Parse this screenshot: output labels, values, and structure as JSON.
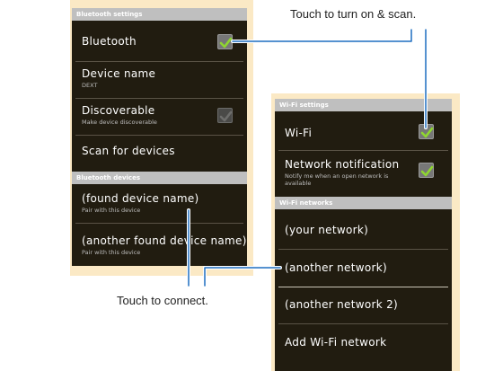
{
  "callouts": {
    "scan": "Touch to turn on & scan.",
    "connect": "Touch to connect."
  },
  "bluetooth_panel": {
    "header_settings": "Bluetooth settings",
    "bluetooth_label": "Bluetooth",
    "bluetooth_checked": true,
    "device_name_label": "Device name",
    "device_name_value": "DEXT",
    "discoverable_label": "Discoverable",
    "discoverable_sub": "Make device discoverable",
    "discoverable_checked": true,
    "scan_label": "Scan for devices",
    "header_devices": "Bluetooth devices",
    "devices": [
      {
        "name": "(found device name)",
        "sub": "Pair with this device"
      },
      {
        "name": "(another found device name)",
        "sub": "Pair with this device"
      }
    ]
  },
  "wifi_panel": {
    "header_settings": "Wi-Fi settings",
    "wifi_label": "Wi-Fi",
    "wifi_checked": true,
    "notification_label": "Network notification",
    "notification_sub_line1": "Notify me when an open network is",
    "notification_sub_line2": "available",
    "notification_checked": true,
    "header_networks": "Wi-Fi networks",
    "networks": [
      "(your network)",
      "(another network)",
      "(another network 2)"
    ],
    "add_network_label": "Add Wi-Fi network"
  },
  "colors": {
    "screen_bg": "#211c10",
    "frame_bg": "#fbe9c5",
    "header_bg": "#bfbfbf",
    "check_green": "#8fd630",
    "callout_line": "#1f6fc0"
  }
}
